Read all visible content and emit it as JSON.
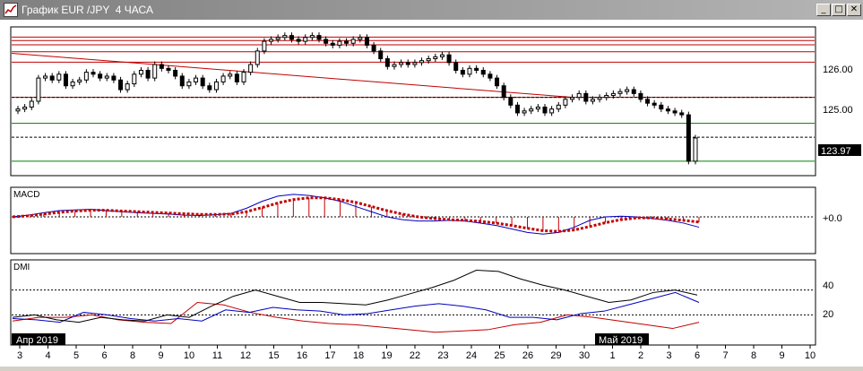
{
  "window": {
    "title": "График EUR /JPY  4 ЧАСА",
    "buttons": {
      "minimize": "_",
      "maximize": "□",
      "close": "✕"
    }
  },
  "colors": {
    "background": "#ffffff",
    "candle": "#000000",
    "red_line": "#c00000",
    "green_line": "#008000",
    "blue": "#0000c0",
    "title_bar": "#808080"
  },
  "chart_data": [
    {
      "type": "candlestick",
      "title": "",
      "price_levels": {
        "red_horizontal": [
          126.56,
          126.47,
          126.36,
          126.18,
          125.91,
          125.0
        ],
        "green_horizontal": [
          124.33,
          123.35
        ],
        "black_dashed": [
          125.0,
          123.97
        ]
      },
      "trendline": {
        "from": {
          "date": "Apr 3",
          "price": 126.14
        },
        "to": {
          "date": "Apr 29",
          "price": 125.0
        }
      },
      "y_tick_labels": [
        "126.00",
        "125.00"
      ],
      "current_price_label": "123.97",
      "ylim": [
        123.0,
        126.8
      ],
      "close_series": [
        124.7,
        124.75,
        124.9,
        125.5,
        125.55,
        125.45,
        125.6,
        125.3,
        125.4,
        125.45,
        125.65,
        125.6,
        125.5,
        125.55,
        125.45,
        125.2,
        125.35,
        125.6,
        125.7,
        125.5,
        125.85,
        125.75,
        125.7,
        125.55,
        125.3,
        125.4,
        125.5,
        125.3,
        125.2,
        125.4,
        125.55,
        125.6,
        125.4,
        125.65,
        125.85,
        126.2,
        126.45,
        126.5,
        126.55,
        126.6,
        126.5,
        126.45,
        126.55,
        126.6,
        126.5,
        126.4,
        126.35,
        126.45,
        126.4,
        126.5,
        126.55,
        126.35,
        126.2,
        126.0,
        125.8,
        125.85,
        125.9,
        125.85,
        125.9,
        125.95,
        126.0,
        126.05,
        126.1,
        125.9,
        125.7,
        125.6,
        125.75,
        125.7,
        125.6,
        125.5,
        125.3,
        125.0,
        124.8,
        124.6,
        124.65,
        124.7,
        124.75,
        124.6,
        124.7,
        124.8,
        124.95,
        125.0,
        125.1,
        124.9,
        124.95,
        125.0,
        125.05,
        125.1,
        125.15,
        125.2,
        125.1,
        124.95,
        124.85,
        124.8,
        124.7,
        124.65,
        124.6,
        124.55,
        123.35,
        123.95
      ]
    },
    {
      "type": "line",
      "title": "MACD",
      "zero_label": "+0.0",
      "series": [
        {
          "values": [
            0.0,
            0.05,
            0.12,
            0.18,
            0.2,
            0.22,
            0.18,
            0.15,
            0.12,
            0.1,
            0.08,
            0.05,
            0.04,
            0.06,
            0.1,
            0.25,
            0.45,
            0.6,
            0.65,
            0.62,
            0.55,
            0.45,
            0.3,
            0.15,
            0.0,
            -0.08,
            -0.12,
            -0.12,
            -0.1,
            -0.12,
            -0.18,
            -0.25,
            -0.35,
            -0.45,
            -0.5,
            -0.45,
            -0.3,
            -0.1,
            0.0,
            0.02,
            0.0,
            -0.05,
            -0.1,
            -0.18,
            -0.3
          ]
        },
        {
          "values": [
            0.0,
            0.03,
            0.08,
            0.13,
            0.17,
            0.19,
            0.19,
            0.17,
            0.15,
            0.13,
            0.11,
            0.09,
            0.07,
            0.07,
            0.08,
            0.15,
            0.27,
            0.4,
            0.5,
            0.55,
            0.55,
            0.5,
            0.42,
            0.3,
            0.18,
            0.08,
            0.0,
            -0.05,
            -0.08,
            -0.1,
            -0.13,
            -0.18,
            -0.25,
            -0.33,
            -0.4,
            -0.42,
            -0.38,
            -0.28,
            -0.17,
            -0.08,
            -0.03,
            -0.03,
            -0.06,
            -0.1,
            -0.15
          ]
        }
      ]
    },
    {
      "type": "line",
      "title": "DMI",
      "y_tick_labels": [
        "40",
        "20"
      ],
      "series": [
        {
          "values": [
            15,
            18,
            18,
            20,
            16,
            14,
            13,
            30,
            28,
            22,
            18,
            15,
            13,
            12,
            10,
            8,
            6,
            7,
            8,
            12,
            14,
            20,
            18,
            15,
            12,
            9,
            14
          ]
        },
        {
          "values": [
            17,
            16,
            14,
            22,
            20,
            17,
            15,
            17,
            15,
            24,
            22,
            26,
            24,
            23,
            20,
            21,
            24,
            27,
            29,
            27,
            24,
            18,
            18,
            16,
            21,
            23,
            28,
            33,
            38,
            30
          ]
        },
        {
          "values": [
            18,
            20,
            16,
            14,
            18,
            16,
            15,
            20,
            18,
            27,
            35,
            40,
            35,
            30,
            30,
            29,
            28,
            32,
            37,
            42,
            48,
            56,
            55,
            49,
            44,
            40,
            35,
            30,
            32,
            38,
            40,
            36
          ]
        }
      ]
    }
  ],
  "x_axis": {
    "date_labels": [
      "3",
      "4",
      "5",
      "6",
      "8",
      "9",
      "10",
      "11",
      "12",
      "15",
      "16",
      "17",
      "18",
      "19",
      "22",
      "23",
      "24",
      "25",
      "26",
      "29",
      "30",
      "1",
      "2",
      "3",
      "6",
      "7",
      "8",
      "9",
      "10"
    ],
    "month_labels": [
      "Апр 2019",
      "Май 2019"
    ]
  }
}
